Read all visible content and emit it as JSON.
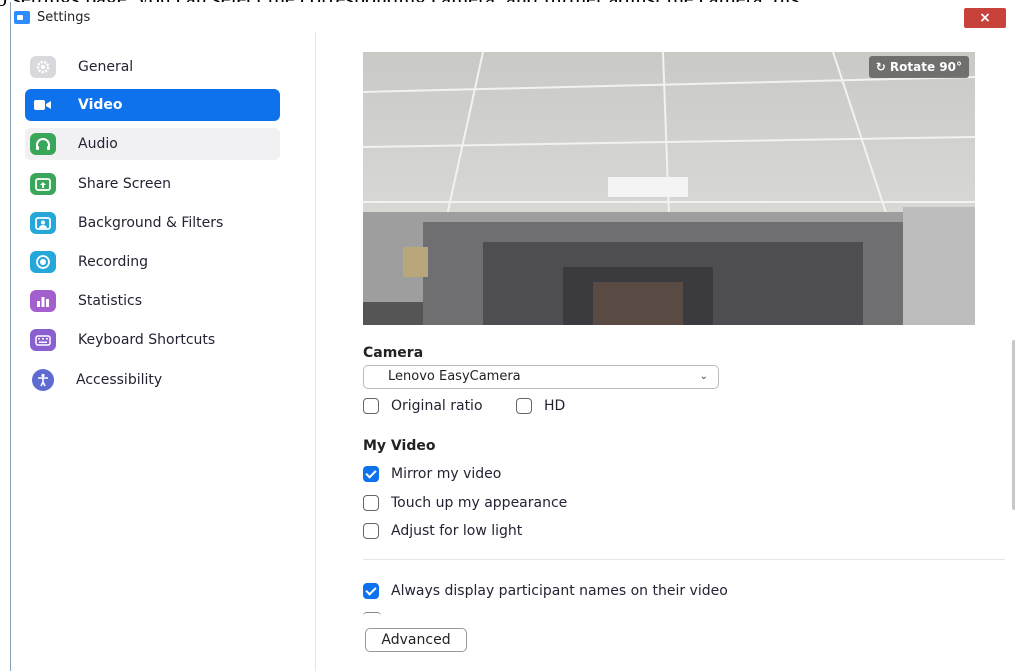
{
  "caption": "o settings page, you can select the corresponding camera, and further adjust the camera, dis",
  "window": {
    "title": "Settings",
    "close_label": "×"
  },
  "sidebar": {
    "items": [
      {
        "label": "General",
        "icon": "gear-icon",
        "color": "#cfcfd3"
      },
      {
        "label": "Video",
        "icon": "video-camera-icon",
        "color": "#0e72ed"
      },
      {
        "label": "Audio",
        "icon": "headphones-icon",
        "color": "#3aa65a"
      },
      {
        "label": "Share Screen",
        "icon": "share-screen-icon",
        "color": "#3aa65a"
      },
      {
        "label": "Background & Filters",
        "icon": "background-icon",
        "color": "#25a7d9"
      },
      {
        "label": "Recording",
        "icon": "record-icon",
        "color": "#25a7d9"
      },
      {
        "label": "Statistics",
        "icon": "statistics-icon",
        "color": "#a45fcf"
      },
      {
        "label": "Keyboard Shortcuts",
        "icon": "keyboard-icon",
        "color": "#8a5fd0"
      },
      {
        "label": "Accessibility",
        "icon": "accessibility-icon",
        "color": "#5f6bd0"
      }
    ]
  },
  "video": {
    "rotate_label": "Rotate 90°",
    "camera_title": "Camera",
    "camera_value": "Lenovo EasyCamera",
    "original_ratio_label": "Original ratio",
    "hd_label": "HD",
    "my_video_title": "My Video",
    "mirror_label": "Mirror my video",
    "touch_up_label": "Touch up my appearance",
    "low_light_label": "Adjust for low light",
    "always_display_label": "Always display participant names on their video",
    "advanced_label": "Advanced"
  }
}
